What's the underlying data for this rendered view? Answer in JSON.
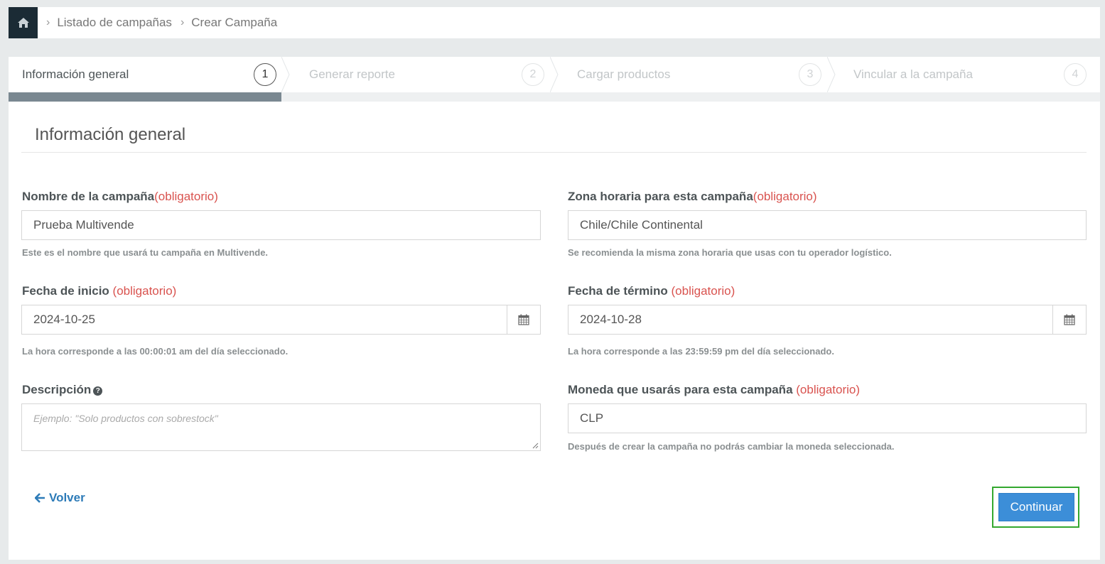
{
  "breadcrumb": {
    "items": [
      "Listado de campañas",
      "Crear Campaña"
    ]
  },
  "steps": [
    {
      "label": "Información general",
      "number": "1",
      "active": true
    },
    {
      "label": "Generar reporte",
      "number": "2",
      "active": false
    },
    {
      "label": "Cargar productos",
      "number": "3",
      "active": false
    },
    {
      "label": "Vincular a la campaña",
      "number": "4",
      "active": false
    }
  ],
  "panel": {
    "title": "Información general"
  },
  "form": {
    "name": {
      "label": "Nombre de la campaña",
      "required": "(obligatorio)",
      "value": "Prueba Multivende",
      "help": "Este es el nombre que usará tu campaña en Multivende."
    },
    "timezone": {
      "label": "Zona horaria para esta campaña",
      "required": "(obligatorio)",
      "value": "Chile/Chile Continental",
      "help": "Se recomienda la misma zona horaria que usas con tu operador logístico."
    },
    "start_date": {
      "label": "Fecha de inicio",
      "required": "(obligatorio)",
      "value": "2024-10-25",
      "help": "La hora corresponde a las 00:00:01 am del día seleccionado."
    },
    "end_date": {
      "label": "Fecha de término",
      "required": "(obligatorio)",
      "value": "2024-10-28",
      "help": "La hora corresponde a las 23:59:59 pm del día seleccionado."
    },
    "description": {
      "label": "Descripción",
      "placeholder": "Ejemplo: \"Solo productos con sobrestock\""
    },
    "currency": {
      "label": "Moneda que usarás para esta campaña",
      "required": "(obligatorio)",
      "value": "CLP",
      "help": "Después de crear la campaña no podrás cambiar la moneda seleccionada."
    }
  },
  "actions": {
    "back_label": "Volver",
    "continue_label": "Continuar"
  },
  "colors": {
    "accent": "#3c8ed8",
    "required": "#d9534f",
    "highlight": "#34a82f",
    "home_bg": "#1b2b35"
  },
  "icons": [
    "home-icon",
    "chevron-right-icon",
    "calendar-icon",
    "question-circle-icon",
    "arrow-left-icon"
  ]
}
